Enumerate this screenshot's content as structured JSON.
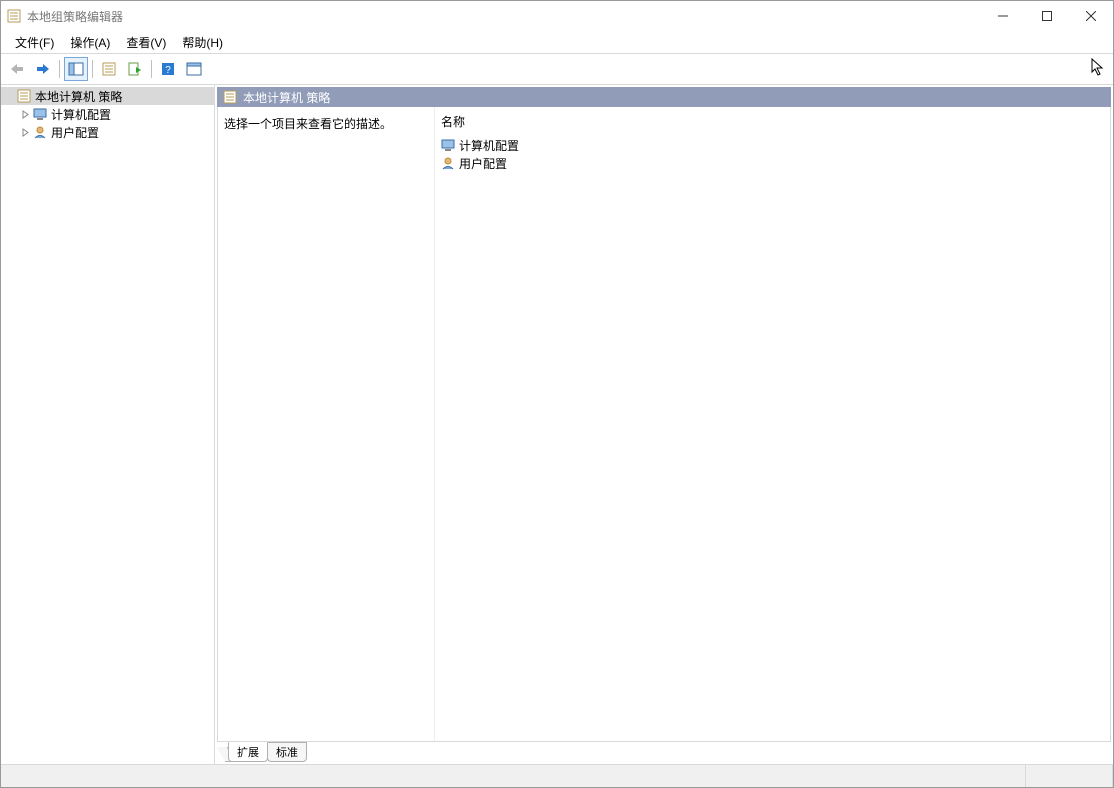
{
  "window": {
    "title": "本地组策略编辑器"
  },
  "menu": {
    "file": "文件(F)",
    "action": "操作(A)",
    "view": "查看(V)",
    "help": "帮助(H)"
  },
  "tree": {
    "root": "本地计算机 策略",
    "computer": "计算机配置",
    "user": "用户配置"
  },
  "detail": {
    "header": "本地计算机 策略",
    "description_hint": "选择一个项目来查看它的描述。",
    "column_name": "名称",
    "items": {
      "computer": "计算机配置",
      "user": "用户配置"
    }
  },
  "tabs": {
    "extended": "扩展",
    "standard": "标准"
  }
}
